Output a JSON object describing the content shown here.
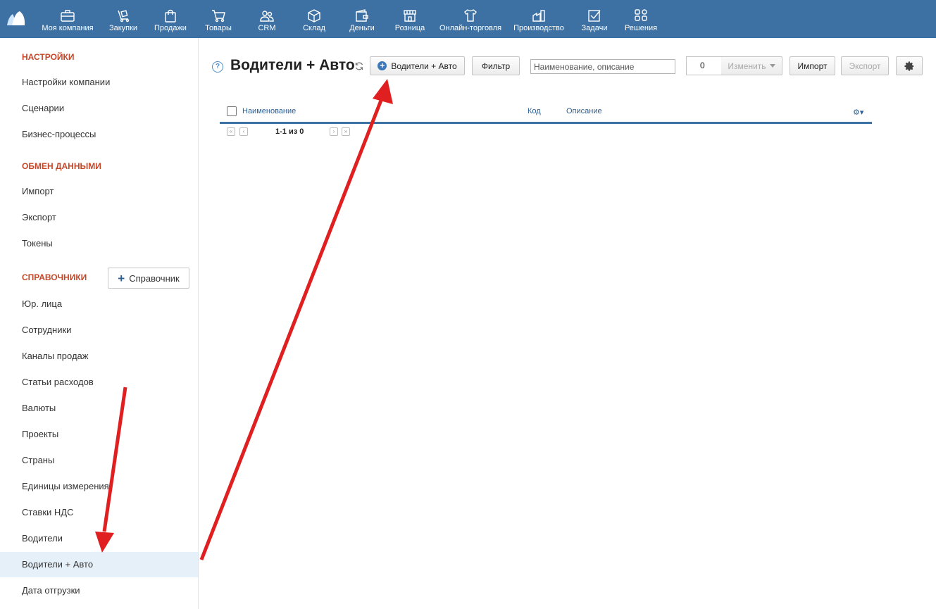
{
  "nav": {
    "items": [
      {
        "label": "Моя компания",
        "icon": "briefcase-icon"
      },
      {
        "label": "Закупки",
        "icon": "cart-dolly-icon"
      },
      {
        "label": "Продажи",
        "icon": "shopping-bag-icon"
      },
      {
        "label": "Товары",
        "icon": "shopping-cart-icon"
      },
      {
        "label": "CRM",
        "icon": "users-icon"
      },
      {
        "label": "Склад",
        "icon": "box-icon"
      },
      {
        "label": "Деньги",
        "icon": "wallet-icon"
      },
      {
        "label": "Розница",
        "icon": "store-icon"
      },
      {
        "label": "Онлайн-торговля",
        "icon": "shirt-icon"
      },
      {
        "label": "Производство",
        "icon": "factory-icon"
      },
      {
        "label": "Задачи",
        "icon": "checkbox-icon"
      },
      {
        "label": "Решения",
        "icon": "grid-icon"
      }
    ]
  },
  "sidebar": {
    "section_settings": "НАСТРОЙКИ",
    "settings_items": [
      "Настройки компании",
      "Сценарии",
      "Бизнес-процессы"
    ],
    "section_exchange": "ОБМЕН ДАННЫМИ",
    "exchange_items": [
      "Импорт",
      "Экспорт",
      "Токены"
    ],
    "section_refs": "СПРАВОЧНИКИ",
    "add_ref_label": "Справочник",
    "ref_items": [
      "Юр. лица",
      "Сотрудники",
      "Каналы продаж",
      "Статьи расходов",
      "Валюты",
      "Проекты",
      "Страны",
      "Единицы измерения",
      "Ставки НДС",
      "Водители",
      "Водители + Авто",
      "Дата отгрузки"
    ],
    "active_item": "Водители + Авто"
  },
  "main": {
    "title": "Водители + Авто",
    "create_button": "Водители + Авто",
    "filter_button": "Фильтр",
    "search_placeholder": "Наименование, описание",
    "selected_count": "0",
    "change_button": "Изменить",
    "import_button": "Импорт",
    "export_button": "Экспорт"
  },
  "table": {
    "columns": [
      "Наименование",
      "Код",
      "Описание"
    ],
    "pager_text": "1-1 из 0"
  },
  "colors": {
    "nav_bg": "#3d71a3",
    "section_title": "#c4472a",
    "active_bg": "#e6f0f9",
    "arrow": "#e02020"
  }
}
